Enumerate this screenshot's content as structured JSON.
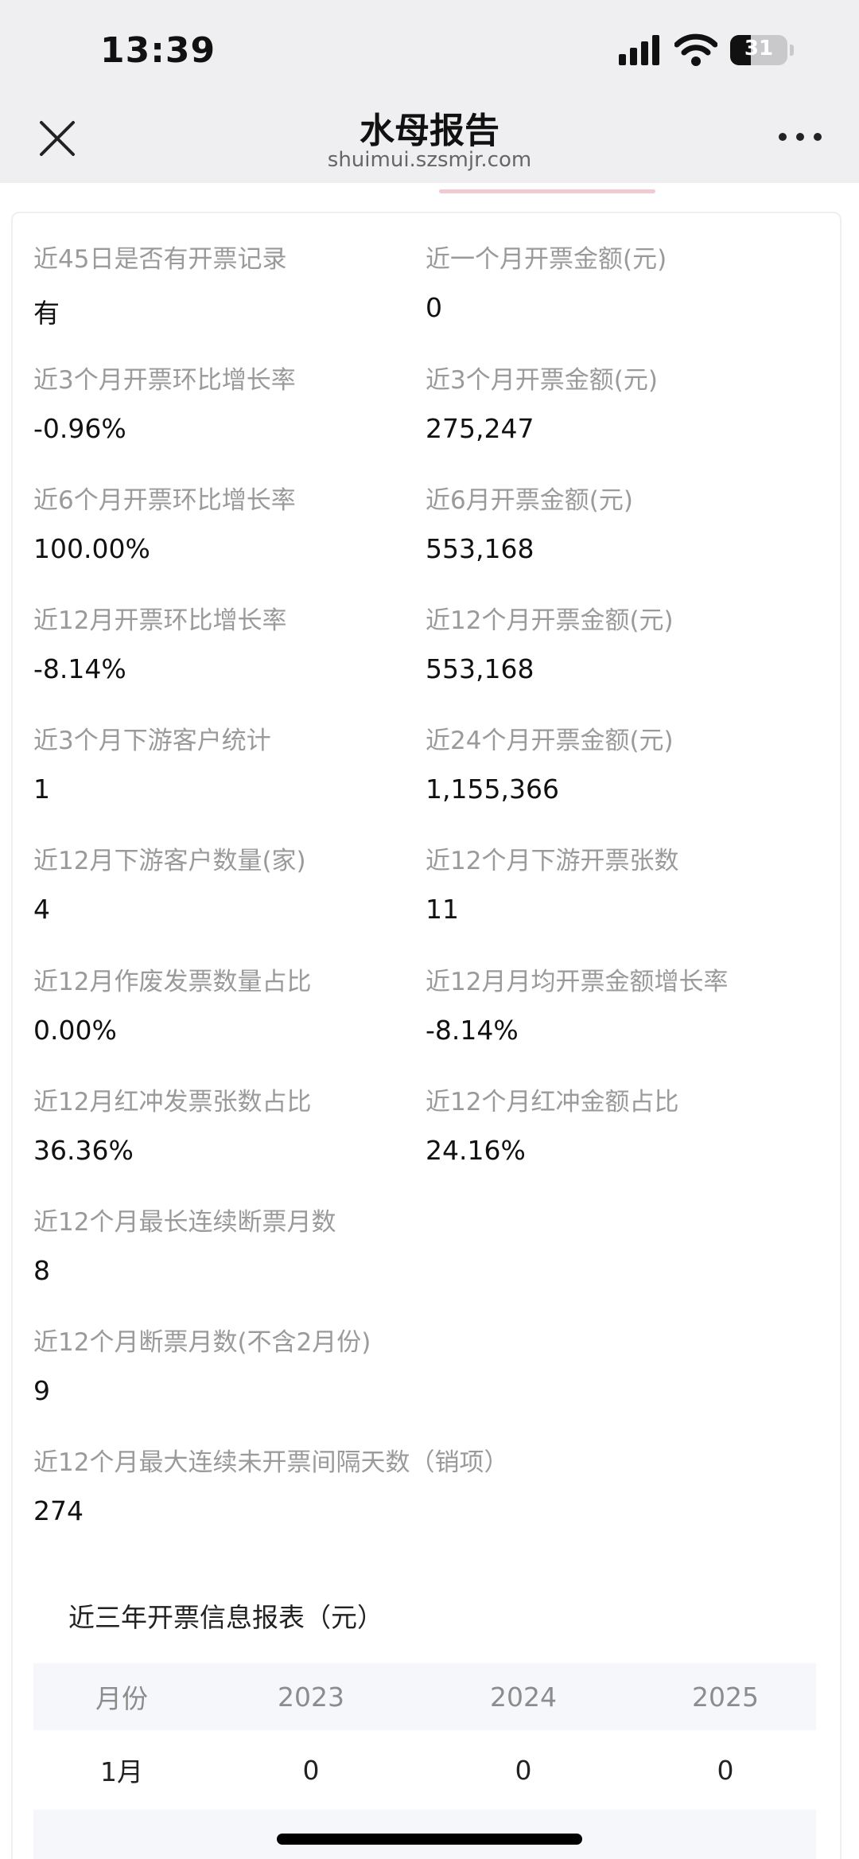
{
  "status_bar": {
    "time": "13:39",
    "battery": "31",
    "battery_level": 0.31,
    "icons": [
      "signal-icon",
      "wifi-icon",
      "battery-icon"
    ]
  },
  "nav": {
    "title": "水母报告",
    "url": "shuimui.szsmjr.com",
    "icons": [
      "close-icon",
      "more-icon"
    ]
  },
  "metrics": [
    {
      "label": "近45日是否有开票记录",
      "value": "有"
    },
    {
      "label": "近一个月开票金额(元)",
      "value": "0"
    },
    {
      "label": "近3个月开票环比增长率",
      "value": "-0.96%"
    },
    {
      "label": "近3个月开票金额(元)",
      "value": "275,247"
    },
    {
      "label": "近6个月开票环比增长率",
      "value": "100.00%"
    },
    {
      "label": "近6月开票金额(元)",
      "value": "553,168"
    },
    {
      "label": "近12月开票环比增长率",
      "value": "-8.14%"
    },
    {
      "label": "近12个月开票金额(元)",
      "value": "553,168"
    },
    {
      "label": "近3个月下游客户统计",
      "value": "1"
    },
    {
      "label": "近24个月开票金额(元)",
      "value": "1,155,366"
    },
    {
      "label": "近12月下游客户数量(家)",
      "value": "4"
    },
    {
      "label": "近12个月下游开票张数",
      "value": "11"
    },
    {
      "label": "近12月作废发票数量占比",
      "value": "0.00%"
    },
    {
      "label": "近12月月均开票金额增长率",
      "value": "-8.14%"
    },
    {
      "label": "近12月红冲发票张数占比",
      "value": "36.36%"
    },
    {
      "label": "近12个月红冲金额占比",
      "value": "24.16%"
    },
    {
      "label": "近12个月最长连续断票月数",
      "value": "8"
    },
    {
      "label": "近12个月断票月数(不含2月份)",
      "value": "9"
    },
    {
      "label": "近12个月最大连续未开票间隔天数（销项）",
      "value": "274"
    }
  ],
  "report_table": {
    "title": "近三年开票信息报表（元）",
    "columns": [
      "月份",
      "2023",
      "2024",
      "2025"
    ],
    "rows": [
      [
        "1月",
        "0",
        "0",
        "0"
      ]
    ]
  }
}
